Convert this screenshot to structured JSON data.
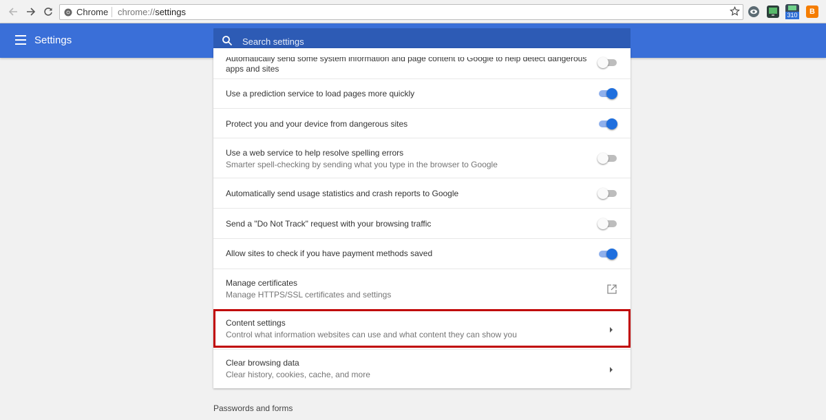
{
  "browser": {
    "tab_chip": "Chrome",
    "url_scheme": "chrome://",
    "url_path": "settings",
    "ext_badge": "310",
    "ext_blogger_letter": "B"
  },
  "header": {
    "title": "Settings",
    "search_placeholder": "Search settings"
  },
  "settings": {
    "rows": [
      {
        "label": "Automatically send some system information and page content to Google to help detect dangerous",
        "label2": "apps and sites",
        "control": "toggle",
        "state": "off"
      },
      {
        "label": "Use a prediction service to load pages more quickly",
        "control": "toggle",
        "state": "on"
      },
      {
        "label": "Protect you and your device from dangerous sites",
        "control": "toggle",
        "state": "on"
      },
      {
        "label": "Use a web service to help resolve spelling errors",
        "sub": "Smarter spell-checking by sending what you type in the browser to Google",
        "control": "toggle",
        "state": "off"
      },
      {
        "label": "Automatically send usage statistics and crash reports to Google",
        "control": "toggle",
        "state": "off"
      },
      {
        "label": "Send a \"Do Not Track\" request with your browsing traffic",
        "control": "toggle",
        "state": "off"
      },
      {
        "label": "Allow sites to check if you have payment methods saved",
        "control": "toggle",
        "state": "on"
      },
      {
        "label": "Manage certificates",
        "sub": "Manage HTTPS/SSL certificates and settings",
        "control": "external-link-icon"
      },
      {
        "label": "Content settings",
        "sub": "Control what information websites can use and what content they can show you",
        "control": "arrow-right-icon"
      },
      {
        "label": "Clear browsing data",
        "sub": "Clear history, cookies, cache, and more",
        "control": "arrow-right-icon"
      }
    ]
  },
  "next_section": "Passwords and forms",
  "colors": {
    "header_blue": "#3a6fd8",
    "search_blue": "#2d5bb5",
    "toggle_on": "#1f6fde",
    "highlight": "#c00000"
  }
}
